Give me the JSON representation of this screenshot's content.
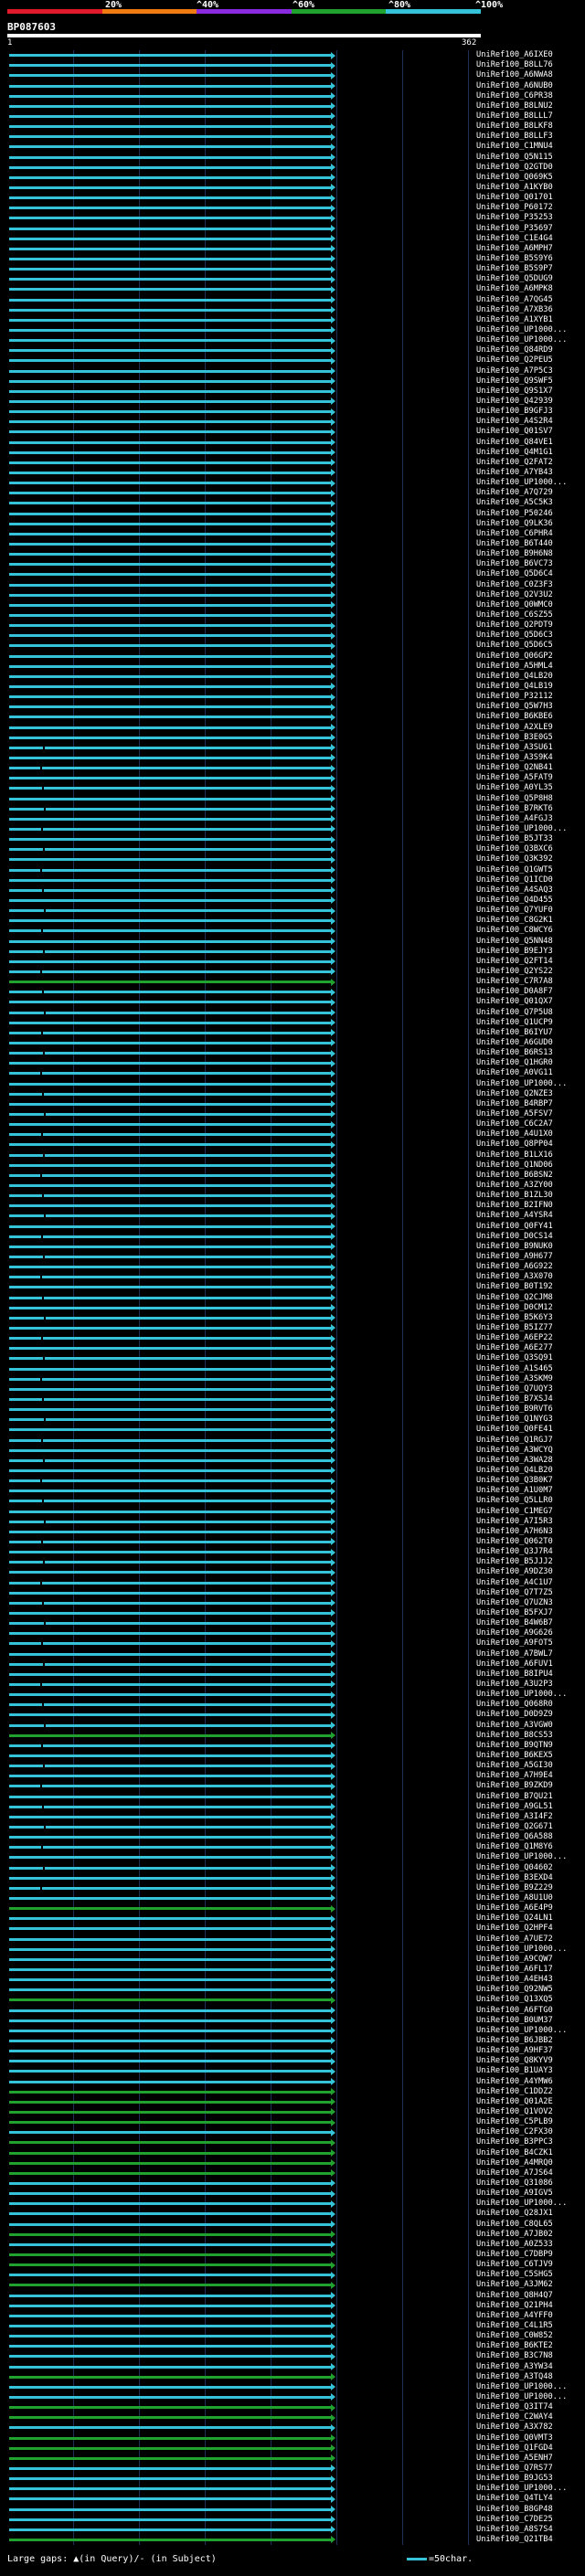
{
  "query": {
    "id": "BP087603",
    "start": "1",
    "end": "362"
  },
  "scale_labels": [
    "20%",
    "^40%",
    "^60%",
    "^80%",
    "^100%"
  ],
  "scale_colors": [
    "#e0192b",
    "#f07b11",
    "#8a2be2",
    "#21a12e",
    "#35c3d9"
  ],
  "colors": {
    "high": "#35c3d9",
    "medium": "#21a12e",
    "grid": "#1c2f55"
  },
  "legend": {
    "text": "Large gaps: ▲(in Query)/- (in Subject)"
  },
  "scale_note": "=50char.",
  "hits": [
    {
      "label": "UniRef100_A6IXE0",
      "c": "h"
    },
    {
      "label": "UniRef100_B8LL76",
      "c": "h"
    },
    {
      "label": "UniRef100_A6NWA8",
      "c": "h"
    },
    {
      "label": "UniRef100_A6NUB0",
      "c": "h"
    },
    {
      "label": "UniRef100_C6PR38",
      "c": "h"
    },
    {
      "label": "UniRef100_B8LNU2",
      "c": "h"
    },
    {
      "label": "UniRef100_B8LLL7",
      "c": "h"
    },
    {
      "label": "UniRef100_B8LKF8",
      "c": "h"
    },
    {
      "label": "UniRef100_B8LLF3",
      "c": "h"
    },
    {
      "label": "UniRef100_C1MNU4",
      "c": "h"
    },
    {
      "label": "UniRef100_Q5N115",
      "c": "h"
    },
    {
      "label": "UniRef100_Q2GTD0",
      "c": "h"
    },
    {
      "label": "UniRef100_Q069K5",
      "c": "h"
    },
    {
      "label": "UniRef100_A1KYB0",
      "c": "h"
    },
    {
      "label": "UniRef100_Q01701",
      "c": "h"
    },
    {
      "label": "UniRef100_P60172",
      "c": "h"
    },
    {
      "label": "UniRef100_P35253",
      "c": "h"
    },
    {
      "label": "UniRef100_P35697",
      "c": "h"
    },
    {
      "label": "UniRef100_C1E4G4",
      "c": "h"
    },
    {
      "label": "UniRef100_A6MPH7",
      "c": "h"
    },
    {
      "label": "UniRef100_B5S9Y6",
      "c": "h"
    },
    {
      "label": "UniRef100_B5S9P7",
      "c": "h"
    },
    {
      "label": "UniRef100_Q5DUG9",
      "c": "h"
    },
    {
      "label": "UniRef100_A6MPK8",
      "c": "h"
    },
    {
      "label": "UniRef100_A7QG45",
      "c": "h"
    },
    {
      "label": "UniRef100_A7XB36",
      "c": "h"
    },
    {
      "label": "UniRef100_A1XYB1",
      "c": "h"
    },
    {
      "label": "UniRef100_UP1000...",
      "c": "h"
    },
    {
      "label": "UniRef100_UP1000...",
      "c": "h"
    },
    {
      "label": "UniRef100_Q84RD9",
      "c": "h"
    },
    {
      "label": "UniRef100_Q2PEU5",
      "c": "h"
    },
    {
      "label": "UniRef100_A7P5C3",
      "c": "h"
    },
    {
      "label": "UniRef100_Q9SWF5",
      "c": "h"
    },
    {
      "label": "UniRef100_Q9S1X7",
      "c": "h"
    },
    {
      "label": "UniRef100_Q42939",
      "c": "h"
    },
    {
      "label": "UniRef100_B9GFJ3",
      "c": "h"
    },
    {
      "label": "UniRef100_A4S2R4",
      "c": "h"
    },
    {
      "label": "UniRef100_Q01SV7",
      "c": "h"
    },
    {
      "label": "UniRef100_Q84VE1",
      "c": "h"
    },
    {
      "label": "UniRef100_Q4M1G1",
      "c": "h"
    },
    {
      "label": "UniRef100_Q2FAT2",
      "c": "h"
    },
    {
      "label": "UniRef100_A7YB43",
      "c": "h"
    },
    {
      "label": "UniRef100_UP1000...",
      "c": "h"
    },
    {
      "label": "UniRef100_A7Q729",
      "c": "h"
    },
    {
      "label": "UniRef100_A5C5K3",
      "c": "h"
    },
    {
      "label": "UniRef100_P50246",
      "c": "h"
    },
    {
      "label": "UniRef100_Q9LK36",
      "c": "h"
    },
    {
      "label": "UniRef100_C6PHR4",
      "c": "h"
    },
    {
      "label": "UniRef100_B6T440",
      "c": "h"
    },
    {
      "label": "UniRef100_B9H6N8",
      "c": "h"
    },
    {
      "label": "UniRef100_B6VC73",
      "c": "h"
    },
    {
      "label": "UniRef100_Q5D6C4",
      "c": "h"
    },
    {
      "label": "UniRef100_C0Z3F3",
      "c": "h"
    },
    {
      "label": "UniRef100_Q2V3U2",
      "c": "h"
    },
    {
      "label": "UniRef100_Q0WMC0",
      "c": "h"
    },
    {
      "label": "UniRef100_C6SZ55",
      "c": "h"
    },
    {
      "label": "UniRef100_Q2PDT9",
      "c": "h"
    },
    {
      "label": "UniRef100_Q5D6C3",
      "c": "h"
    },
    {
      "label": "UniRef100_Q5D6C5",
      "c": "h"
    },
    {
      "label": "UniRef100_Q06GP2",
      "c": "h"
    },
    {
      "label": "UniRef100_A5HML4",
      "c": "h"
    },
    {
      "label": "UniRef100_Q4LB20",
      "c": "h"
    },
    {
      "label": "UniRef100_Q4LB19",
      "c": "h"
    },
    {
      "label": "UniRef100_P32112",
      "c": "h"
    },
    {
      "label": "UniRef100_Q5W7H3",
      "c": "h"
    },
    {
      "label": "UniRef100_B6KBE6",
      "c": "h"
    },
    {
      "label": "UniRef100_A2XLE9",
      "c": "h"
    },
    {
      "label": "UniRef100_B3E0G5",
      "c": "h"
    },
    {
      "label": "UniRef100_A3SU61",
      "c": "h"
    },
    {
      "label": "UniRef100_A3S9K4",
      "c": "h"
    },
    {
      "label": "UniRef100_Q2NB41",
      "c": "h"
    },
    {
      "label": "UniRef100_A5FAT9",
      "c": "h"
    },
    {
      "label": "UniRef100_A0YL35",
      "c": "h"
    },
    {
      "label": "UniRef100_Q5P8H8",
      "c": "h"
    },
    {
      "label": "UniRef100_B7RKT6",
      "c": "h"
    },
    {
      "label": "UniRef100_A4FGJ3",
      "c": "h"
    },
    {
      "label": "UniRef100_UP1000...",
      "c": "h"
    },
    {
      "label": "UniRef100_B5JT33",
      "c": "h"
    },
    {
      "label": "UniRef100_Q3BXC6",
      "c": "h"
    },
    {
      "label": "UniRef100_Q3K392",
      "c": "h"
    },
    {
      "label": "UniRef100_Q1GWT5",
      "c": "h"
    },
    {
      "label": "UniRef100_Q1ICD0",
      "c": "h"
    },
    {
      "label": "UniRef100_A4SAQ3",
      "c": "h"
    },
    {
      "label": "UniRef100_Q4D455",
      "c": "h"
    },
    {
      "label": "UniRef100_Q7YUF0",
      "c": "h"
    },
    {
      "label": "UniRef100_C8G2K1",
      "c": "h"
    },
    {
      "label": "UniRef100_C8WCY6",
      "c": "h"
    },
    {
      "label": "UniRef100_Q5NN48",
      "c": "h"
    },
    {
      "label": "UniRef100_B9EJY3",
      "c": "h"
    },
    {
      "label": "UniRef100_Q2FT14",
      "c": "h"
    },
    {
      "label": "UniRef100_Q2YS22",
      "c": "h"
    },
    {
      "label": "UniRef100_C7R7A8",
      "c": "m"
    },
    {
      "label": "UniRef100_D0A8F7",
      "c": "h"
    },
    {
      "label": "UniRef100_Q01QX7",
      "c": "h"
    },
    {
      "label": "UniRef100_Q7P5U8",
      "c": "h"
    },
    {
      "label": "UniRef100_Q1UCP9",
      "c": "h"
    },
    {
      "label": "UniRef100_B6IYU7",
      "c": "h"
    },
    {
      "label": "UniRef100_A6GUD0",
      "c": "h"
    },
    {
      "label": "UniRef100_B6RS13",
      "c": "h"
    },
    {
      "label": "UniRef100_Q1HGR0",
      "c": "h"
    },
    {
      "label": "UniRef100_A0VG11",
      "c": "h"
    },
    {
      "label": "UniRef100_UP1000...",
      "c": "h"
    },
    {
      "label": "UniRef100_Q2NZE3",
      "c": "h"
    },
    {
      "label": "UniRef100_B4RBP7",
      "c": "h"
    },
    {
      "label": "UniRef100_A5FSV7",
      "c": "h"
    },
    {
      "label": "UniRef100_C6C2A7",
      "c": "h"
    },
    {
      "label": "UniRef100_A4U1X0",
      "c": "h"
    },
    {
      "label": "UniRef100_Q8PP04",
      "c": "h"
    },
    {
      "label": "UniRef100_B1LX16",
      "c": "h"
    },
    {
      "label": "UniRef100_Q1ND06",
      "c": "h"
    },
    {
      "label": "UniRef100_B6BSN2",
      "c": "h"
    },
    {
      "label": "UniRef100_A3ZY00",
      "c": "h"
    },
    {
      "label": "UniRef100_B1ZL30",
      "c": "h"
    },
    {
      "label": "UniRef100_B2IFN0",
      "c": "h"
    },
    {
      "label": "UniRef100_A4YSR4",
      "c": "h"
    },
    {
      "label": "UniRef100_Q0FY41",
      "c": "h"
    },
    {
      "label": "UniRef100_D0CS14",
      "c": "h"
    },
    {
      "label": "UniRef100_B9NUK0",
      "c": "h"
    },
    {
      "label": "UniRef100_A9H677",
      "c": "h"
    },
    {
      "label": "UniRef100_A6G922",
      "c": "h"
    },
    {
      "label": "UniRef100_A3X070",
      "c": "h"
    },
    {
      "label": "UniRef100_B0T192",
      "c": "h"
    },
    {
      "label": "UniRef100_Q2CJM8",
      "c": "h"
    },
    {
      "label": "UniRef100_D0CM12",
      "c": "h"
    },
    {
      "label": "UniRef100_B5K6Y3",
      "c": "h"
    },
    {
      "label": "UniRef100_B5IZ77",
      "c": "h"
    },
    {
      "label": "UniRef100_A6EP22",
      "c": "h"
    },
    {
      "label": "UniRef100_A6E277",
      "c": "h"
    },
    {
      "label": "UniRef100_Q3SQ91",
      "c": "h"
    },
    {
      "label": "UniRef100_A1S465",
      "c": "h"
    },
    {
      "label": "UniRef100_A3SKM9",
      "c": "h"
    },
    {
      "label": "UniRef100_Q7UQY3",
      "c": "h"
    },
    {
      "label": "UniRef100_B7XSJ4",
      "c": "h"
    },
    {
      "label": "UniRef100_B9RVT6",
      "c": "h"
    },
    {
      "label": "UniRef100_Q1NYG3",
      "c": "h"
    },
    {
      "label": "UniRef100_Q0FE41",
      "c": "h"
    },
    {
      "label": "UniRef100_Q1RGJ7",
      "c": "h"
    },
    {
      "label": "UniRef100_A3WCYQ",
      "c": "h"
    },
    {
      "label": "UniRef100_A3WA28",
      "c": "h"
    },
    {
      "label": "UniRef100_Q4LB20",
      "c": "h"
    },
    {
      "label": "UniRef100_Q3B0K7",
      "c": "h"
    },
    {
      "label": "UniRef100_A1U0M7",
      "c": "h"
    },
    {
      "label": "UniRef100_Q5LLR0",
      "c": "h"
    },
    {
      "label": "UniRef100_C1MEG7",
      "c": "h"
    },
    {
      "label": "UniRef100_A7I5R3",
      "c": "h"
    },
    {
      "label": "UniRef100_A7H6N3",
      "c": "h"
    },
    {
      "label": "UniRef100_Q062T0",
      "c": "h"
    },
    {
      "label": "UniRef100_Q3J7R4",
      "c": "h"
    },
    {
      "label": "UniRef100_B5JJJ2",
      "c": "h"
    },
    {
      "label": "UniRef100_A9DZ30",
      "c": "h"
    },
    {
      "label": "UniRef100_A4C1U7",
      "c": "h"
    },
    {
      "label": "UniRef100_Q7T7Z5",
      "c": "h"
    },
    {
      "label": "UniRef100_Q7UZN3",
      "c": "h"
    },
    {
      "label": "UniRef100_B5FXJ7",
      "c": "h"
    },
    {
      "label": "UniRef100_B4W6B7",
      "c": "h"
    },
    {
      "label": "UniRef100_A9G626",
      "c": "h"
    },
    {
      "label": "UniRef100_A9FOT5",
      "c": "h"
    },
    {
      "label": "UniRef100_A7BWL7",
      "c": "h"
    },
    {
      "label": "UniRef100_A6FUV1",
      "c": "h"
    },
    {
      "label": "UniRef100_B8IPU4",
      "c": "h"
    },
    {
      "label": "UniRef100_A3U2P3",
      "c": "h"
    },
    {
      "label": "UniRef100_UP1000...",
      "c": "h"
    },
    {
      "label": "UniRef100_Q068R0",
      "c": "h"
    },
    {
      "label": "UniRef100_D0D9Z9",
      "c": "h"
    },
    {
      "label": "UniRef100_A3VGW0",
      "c": "h"
    },
    {
      "label": "UniRef100_B8CS53",
      "c": "m"
    },
    {
      "label": "UniRef100_B9QTN9",
      "c": "h"
    },
    {
      "label": "UniRef100_B6KEX5",
      "c": "h"
    },
    {
      "label": "UniRef100_A5GI30",
      "c": "h"
    },
    {
      "label": "UniRef100_A7H9E4",
      "c": "h"
    },
    {
      "label": "UniRef100_B9ZKD9",
      "c": "h"
    },
    {
      "label": "UniRef100_B7QU21",
      "c": "h"
    },
    {
      "label": "UniRef100_A9GL51",
      "c": "h"
    },
    {
      "label": "UniRef100_A3I4F2",
      "c": "h"
    },
    {
      "label": "UniRef100_Q2G671",
      "c": "h"
    },
    {
      "label": "UniRef100_Q6A588",
      "c": "h"
    },
    {
      "label": "UniRef100_Q1M8Y6",
      "c": "h"
    },
    {
      "label": "UniRef100_UP1000...",
      "c": "h"
    },
    {
      "label": "UniRef100_Q04602",
      "c": "h"
    },
    {
      "label": "UniRef100_B3EXD4",
      "c": "h"
    },
    {
      "label": "UniRef100_B9Z229",
      "c": "h"
    },
    {
      "label": "UniRef100_A8U1U0",
      "c": "h"
    },
    {
      "label": "UniRef100_A6E4P9",
      "c": "m"
    },
    {
      "label": "UniRef100_Q24LN1",
      "c": "h"
    },
    {
      "label": "UniRef100_Q2HPF4",
      "c": "h"
    },
    {
      "label": "UniRef100_A7UE72",
      "c": "h"
    },
    {
      "label": "UniRef100_UP1000...",
      "c": "h"
    },
    {
      "label": "UniRef100_A9CQW7",
      "c": "h"
    },
    {
      "label": "UniRef100_A6FL17",
      "c": "h"
    },
    {
      "label": "UniRef100_A4EH43",
      "c": "h"
    },
    {
      "label": "UniRef100_Q92NW5",
      "c": "h"
    },
    {
      "label": "UniRef100_Q13XQ5",
      "c": "m"
    },
    {
      "label": "UniRef100_A6FTG0",
      "c": "h"
    },
    {
      "label": "UniRef100_B0UM37",
      "c": "h"
    },
    {
      "label": "UniRef100_UP1000...",
      "c": "h"
    },
    {
      "label": "UniRef100_B6JBB2",
      "c": "h"
    },
    {
      "label": "UniRef100_A9HF37",
      "c": "h"
    },
    {
      "label": "UniRef100_Q8KYV9",
      "c": "h"
    },
    {
      "label": "UniRef100_B1UAY3",
      "c": "h"
    },
    {
      "label": "UniRef100_A4YMW6",
      "c": "h"
    },
    {
      "label": "UniRef100_C1DDZ2",
      "c": "m"
    },
    {
      "label": "UniRef100_Q01A2E",
      "c": "m"
    },
    {
      "label": "UniRef100_Q1VOV2",
      "c": "m"
    },
    {
      "label": "UniRef100_C5PLB9",
      "c": "m"
    },
    {
      "label": "UniRef100_C2FX30",
      "c": "h"
    },
    {
      "label": "UniRef100_B3PPC3",
      "c": "m"
    },
    {
      "label": "UniRef100_B4CZK1",
      "c": "m"
    },
    {
      "label": "UniRef100_A4MRQ0",
      "c": "m"
    },
    {
      "label": "UniRef100_A7JS64",
      "c": "m"
    },
    {
      "label": "UniRef100_Q31086",
      "c": "h"
    },
    {
      "label": "UniRef100_A9IGV5",
      "c": "h"
    },
    {
      "label": "UniRef100_UP1000...",
      "c": "h"
    },
    {
      "label": "UniRef100_Q28JX1",
      "c": "h"
    },
    {
      "label": "UniRef100_C8QL65",
      "c": "h"
    },
    {
      "label": "UniRef100_A7JB02",
      "c": "m"
    },
    {
      "label": "UniRef100_A0Z533",
      "c": "h"
    },
    {
      "label": "UniRef100_C7DBP9",
      "c": "m"
    },
    {
      "label": "UniRef100_C6TJV9",
      "c": "m"
    },
    {
      "label": "UniRef100_C5SHG5",
      "c": "h"
    },
    {
      "label": "UniRef100_A3JM62",
      "c": "m"
    },
    {
      "label": "UniRef100_Q8H4Q7",
      "c": "h"
    },
    {
      "label": "UniRef100_Q21PH4",
      "c": "h"
    },
    {
      "label": "UniRef100_A4YFF0",
      "c": "h"
    },
    {
      "label": "UniRef100_C4L1R5",
      "c": "h"
    },
    {
      "label": "UniRef100_C0W852",
      "c": "h"
    },
    {
      "label": "UniRef100_B6KTE2",
      "c": "h"
    },
    {
      "label": "UniRef100_B3C7N8",
      "c": "h"
    },
    {
      "label": "UniRef100_A3YW34",
      "c": "h"
    },
    {
      "label": "UniRef100_A3TQ48",
      "c": "m"
    },
    {
      "label": "UniRef100_UP1000...",
      "c": "h"
    },
    {
      "label": "UniRef100_UP1000...",
      "c": "h"
    },
    {
      "label": "UniRef100_Q3IT74",
      "c": "m"
    },
    {
      "label": "UniRef100_C2WAY4",
      "c": "m"
    },
    {
      "label": "UniRef100_A3X782",
      "c": "h"
    },
    {
      "label": "UniRef100_Q0VMT3",
      "c": "m"
    },
    {
      "label": "UniRef100_Q1FGD4",
      "c": "m"
    },
    {
      "label": "UniRef100_A5ENH7",
      "c": "m"
    },
    {
      "label": "UniRef100_Q7RS77",
      "c": "h"
    },
    {
      "label": "UniRef100_B9JG53",
      "c": "h"
    },
    {
      "label": "UniRef100_UP1000...",
      "c": "h"
    },
    {
      "label": "UniRef100_Q4TLY4",
      "c": "h"
    },
    {
      "label": "UniRef100_B8GP48",
      "c": "h"
    },
    {
      "label": "UniRef100_C7DE25",
      "c": "h"
    },
    {
      "label": "UniRef100_A8S7S4",
      "c": "h"
    },
    {
      "label": "UniRef100_Q21TB4",
      "c": "m"
    }
  ]
}
